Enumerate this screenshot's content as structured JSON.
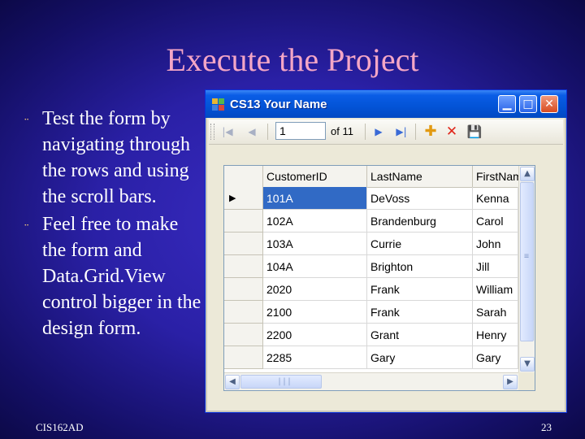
{
  "slide": {
    "title": "Execute the Project",
    "bullets": [
      "Test the form by navigating through the rows and using the scroll bars.",
      "Feel free to make the form and Data.Grid.View control bigger in the design form."
    ],
    "footer_left": "CIS162AD",
    "page_number": "23"
  },
  "window": {
    "title": "CS13 Your Name",
    "controls": {
      "minimize": "▁",
      "maximize": "□",
      "close": "✕"
    }
  },
  "navigator": {
    "position": "1",
    "count_text": "of 11",
    "icons": {
      "first": "|◀",
      "prev": "◀",
      "next": "▶",
      "last": "▶|",
      "add": "✚",
      "delete": "✕",
      "save": "💾"
    }
  },
  "grid": {
    "columns": [
      "CustomerID",
      "LastName",
      "FirstName"
    ],
    "current_row_marker": "▶",
    "rows": [
      [
        "101A",
        "DeVoss",
        "Kenna"
      ],
      [
        "102A",
        "Brandenburg",
        "Carol"
      ],
      [
        "103A",
        "Currie",
        "John"
      ],
      [
        "104A",
        "Brighton",
        "Jill"
      ],
      [
        "2020",
        "Frank",
        "William"
      ],
      [
        "2100",
        "Frank",
        "Sarah"
      ],
      [
        "2200",
        "Grant",
        "Henry"
      ],
      [
        "2285",
        "Gary",
        "Gary"
      ]
    ],
    "selected_row": 0,
    "scroll_icons": {
      "up": "▲",
      "down": "▼",
      "left": "◀",
      "right": "▶"
    }
  },
  "colors": {
    "title": "#f4a6c6",
    "selection": "#316ac5",
    "titlebar": "#0353d6"
  }
}
